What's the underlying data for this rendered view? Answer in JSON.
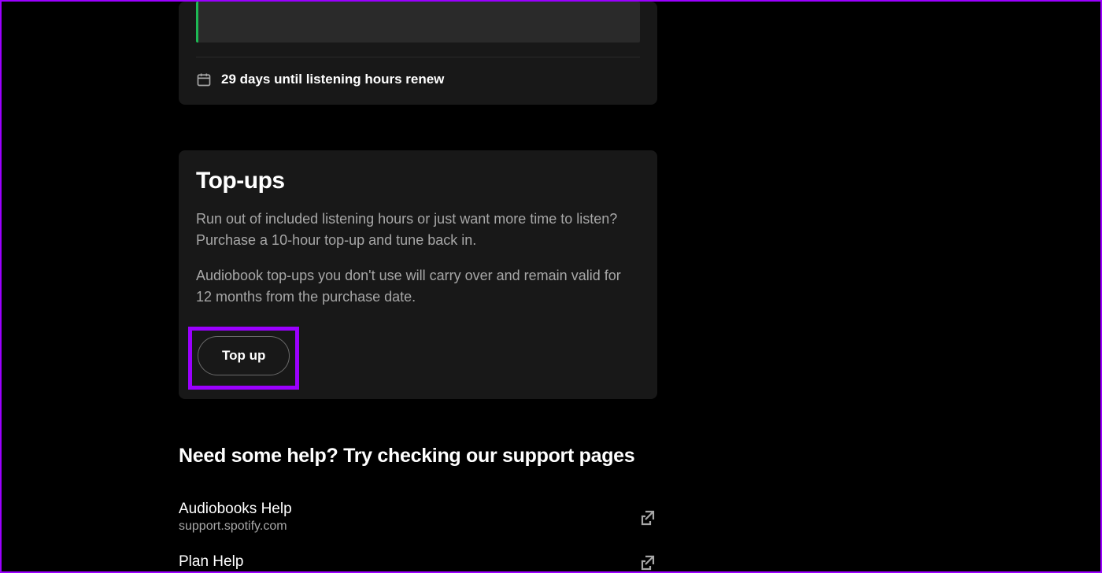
{
  "listening": {
    "renew_text": "29 days until listening hours renew"
  },
  "topups": {
    "title": "Top-ups",
    "desc1": "Run out of included listening hours or just want more time to listen? Purchase a 10-hour top-up and tune back in.",
    "desc2": "Audiobook top-ups you don't use will carry over and remain valid for 12 months from the purchase date.",
    "button_label": "Top up"
  },
  "help": {
    "heading": "Need some help? Try checking our support pages",
    "links": [
      {
        "title": "Audiobooks Help",
        "subtitle": "support.spotify.com"
      },
      {
        "title": "Plan Help",
        "subtitle": ""
      }
    ]
  }
}
